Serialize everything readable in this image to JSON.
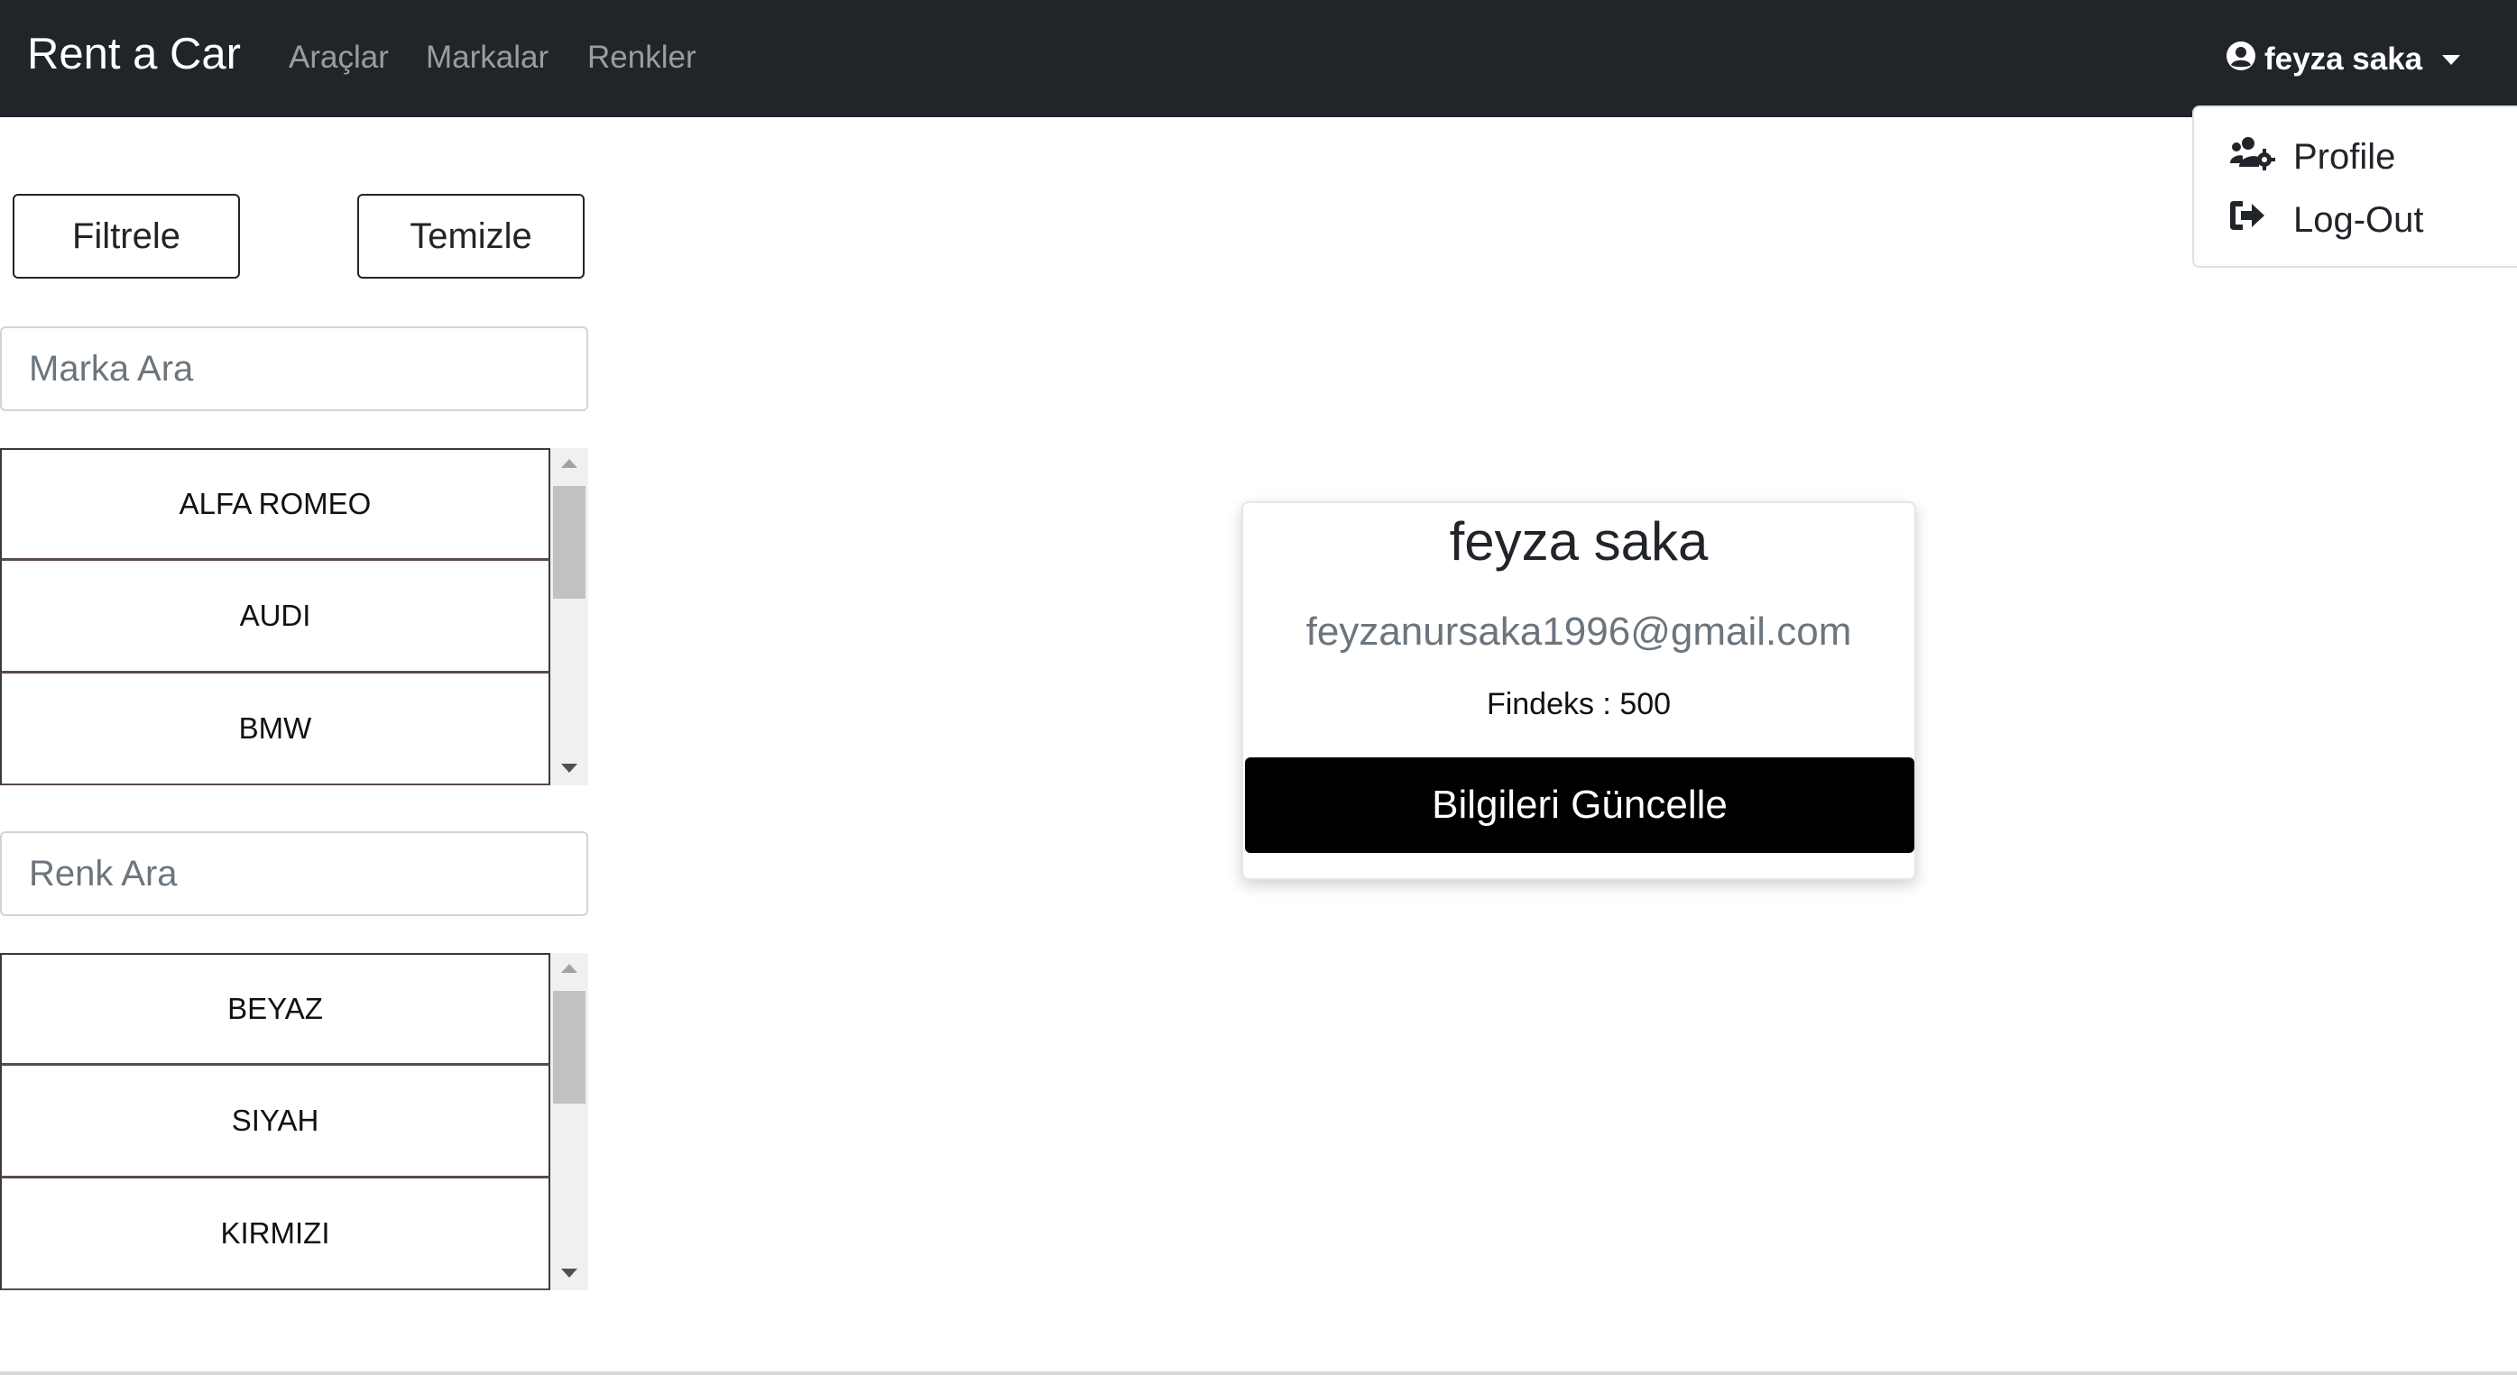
{
  "navbar": {
    "brand": "Rent a Car",
    "links": [
      "Araçlar",
      "Markalar",
      "Renkler"
    ],
    "user_name": "feyza saka",
    "user_icon": "user-circle-icon"
  },
  "dropdown": {
    "items": [
      {
        "label": "Profile",
        "icon": "users-cog-icon"
      },
      {
        "label": "Log-Out",
        "icon": "sign-out-icon"
      }
    ]
  },
  "sidebar": {
    "filter_label": "Filtrele",
    "clear_label": "Temizle",
    "brand_search_placeholder": "Marka Ara",
    "brands": [
      "ALFA ROMEO",
      "AUDI",
      "BMW"
    ],
    "color_search_placeholder": "Renk Ara",
    "colors": [
      "BEYAZ",
      "SIYAH",
      "KIRMIZI"
    ]
  },
  "profile": {
    "name": "feyza saka",
    "email": "feyzanursaka1996@gmail.com",
    "findeks": "Findeks : 500",
    "update_label": "Bilgileri Güncelle"
  },
  "colors": {
    "navbar_bg": "#212529",
    "nav_link": "rgba(255,255,255,0.55)",
    "primary_button": "#000000"
  }
}
